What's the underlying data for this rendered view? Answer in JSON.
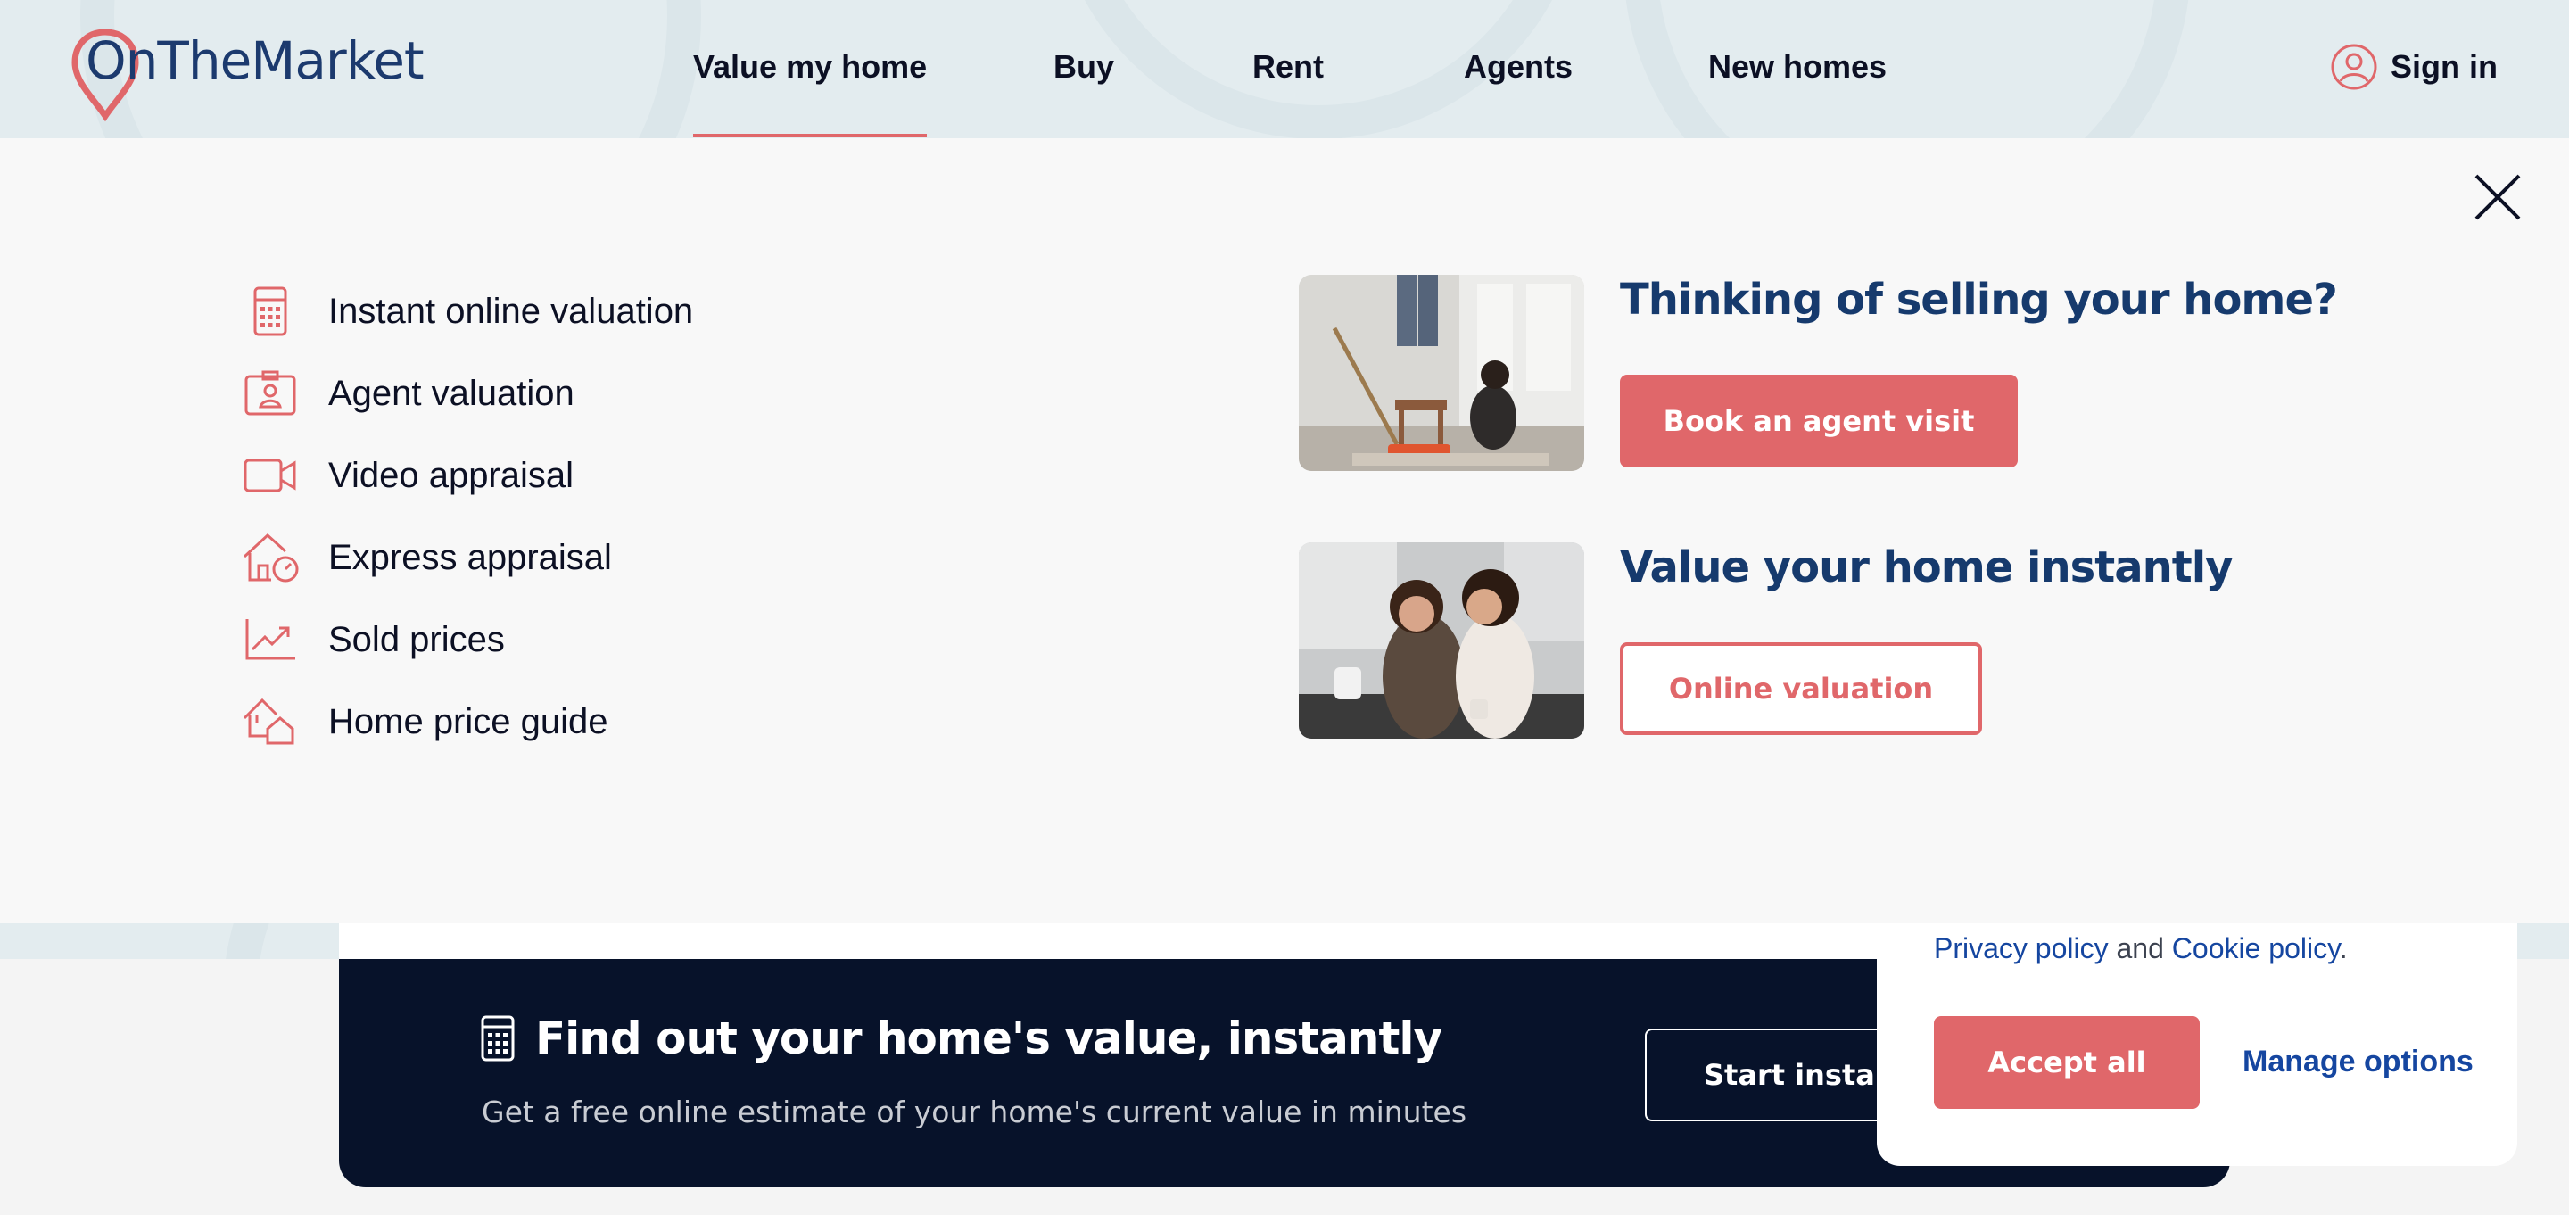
{
  "brand": {
    "name": "OnTheMarket",
    "accent": "#e0676a",
    "navy": "#163a6d"
  },
  "nav": {
    "items": [
      {
        "label": "Value my home",
        "active": true
      },
      {
        "label": "Buy"
      },
      {
        "label": "Rent"
      },
      {
        "label": "Agents"
      },
      {
        "label": "New homes"
      }
    ],
    "signin_label": "Sign in",
    "signin_icon": "user-circle-icon"
  },
  "menu": {
    "items": [
      {
        "label": "Instant online valuation",
        "icon": "calculator-icon"
      },
      {
        "label": "Agent valuation",
        "icon": "id-badge-icon"
      },
      {
        "label": "Video appraisal",
        "icon": "video-camera-icon"
      },
      {
        "label": "Express appraisal",
        "icon": "house-clock-icon"
      },
      {
        "label": "Sold prices",
        "icon": "trend-chart-icon"
      },
      {
        "label": "Home price guide",
        "icon": "houses-icon"
      }
    ],
    "close_icon": "close-icon"
  },
  "promos": [
    {
      "title": "Thinking of selling your home?",
      "button": "Book an agent visit"
    },
    {
      "title": "Value your home instantly",
      "button": "Online valuation"
    }
  ],
  "banner": {
    "title": "Find out your home's value, instantly",
    "subtitle": "Get a free online estimate of your home's current value in minutes",
    "button": "Start instant"
  },
  "cookie": {
    "privacy_link": "Privacy policy",
    "and_text": "and",
    "cookie_link": "Cookie policy",
    "period": ".",
    "accept_label": "Accept all",
    "manage_label": "Manage options"
  }
}
